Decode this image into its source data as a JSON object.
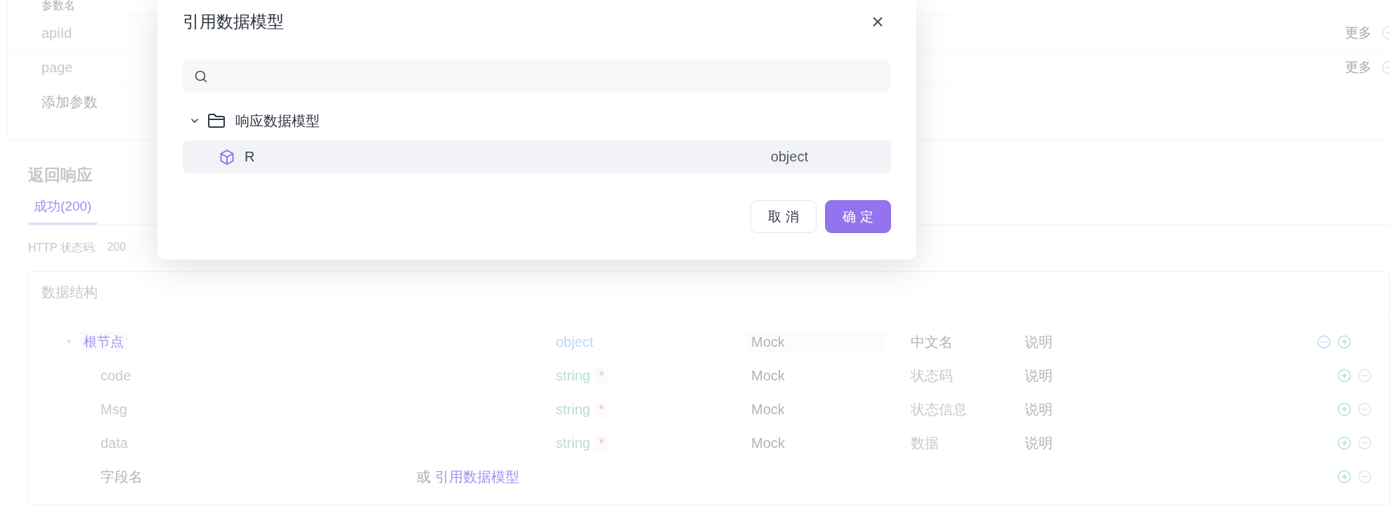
{
  "background": {
    "params": {
      "header": "参数名",
      "rows": [
        {
          "name": "apiId",
          "more": "更多"
        },
        {
          "name": "page",
          "more": "更多"
        }
      ],
      "add_placeholder": "添加参数"
    },
    "response": {
      "title": "返回响应",
      "tabs": [
        {
          "label": "成功(200)",
          "selected": true
        }
      ],
      "status_label": "HTTP 状态码:",
      "status_value": "200",
      "schema": {
        "title": "数据结构",
        "rows": [
          {
            "kind": "root",
            "name": "根节点",
            "expanded": true,
            "type": "object",
            "mock_placeholder": "Mock",
            "cn_placeholder": "中文名",
            "desc_placeholder": "说明"
          },
          {
            "kind": "field",
            "name": "code",
            "type": "string",
            "required_mark": "*",
            "mock_placeholder": "Mock",
            "cn_name": "状态码",
            "desc_placeholder": "说明"
          },
          {
            "kind": "field",
            "name": "Msg",
            "type": "string",
            "required_mark": "*",
            "mock_placeholder": "Mock",
            "cn_name": "状态信息",
            "desc_placeholder": "说明"
          },
          {
            "kind": "field",
            "name": "data",
            "type": "string",
            "required_mark": "*",
            "mock_placeholder": "Mock",
            "cn_name": "数据",
            "desc_placeholder": "说明"
          }
        ],
        "new_field": {
          "placeholder": "字段名",
          "or": "或",
          "link": "引用数据模型"
        }
      }
    }
  },
  "dialog": {
    "title": "引用数据模型",
    "tree": [
      {
        "label": "响应数据模型",
        "expanded": true,
        "children": [
          {
            "label": "R",
            "type": "object",
            "selected": true
          }
        ]
      }
    ],
    "buttons": [
      {
        "label": "取 消",
        "kind": "secondary"
      },
      {
        "label": "确 定",
        "kind": "primary"
      }
    ]
  }
}
